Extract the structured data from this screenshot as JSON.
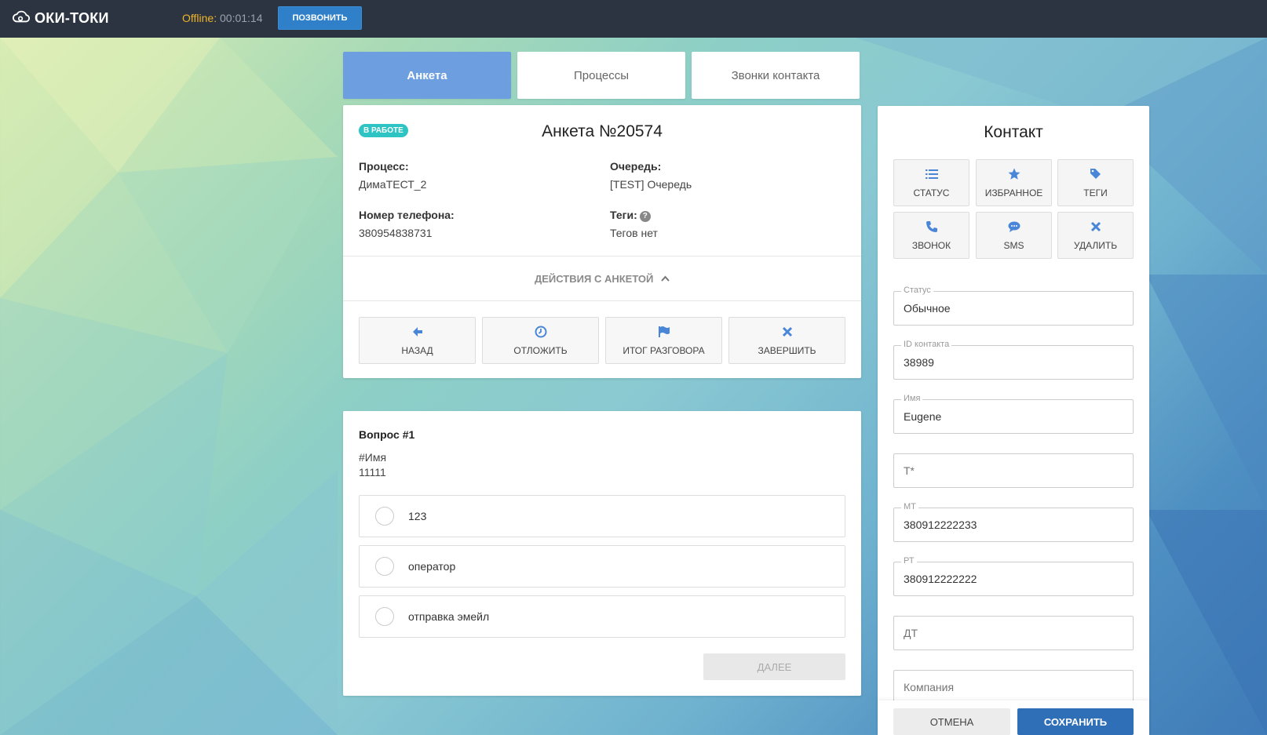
{
  "topbar": {
    "logo_text": "ОКИ-ТОКИ",
    "status_label": "Offline:",
    "status_time": "00:01:14",
    "call_button": "ПОЗВОНИТЬ"
  },
  "tabs": [
    {
      "label": "Анкета",
      "active": true
    },
    {
      "label": "Процессы",
      "active": false
    },
    {
      "label": "Звонки контакта",
      "active": false
    }
  ],
  "anketa": {
    "badge": "В РАБОТЕ",
    "title": "Анкета №20574",
    "process_label": "Процесс:",
    "process_value": "ДимаТЕСТ_2",
    "queue_label": "Очередь:",
    "queue_value": "[TEST] Очередь",
    "phone_label": "Номер телефона:",
    "phone_value": "380954838731",
    "tags_label": "Теги:",
    "tags_value": "Тегов нет",
    "actions_toggle": "ДЕЙСТВИЯ С АНКЕТОЙ",
    "actions": [
      {
        "label": "НАЗАД",
        "icon": "arrow-left-icon"
      },
      {
        "label": "ОТЛОЖИТЬ",
        "icon": "clock-icon"
      },
      {
        "label": "ИТОГ РАЗГОВОРА",
        "icon": "flag-icon"
      },
      {
        "label": "ЗАВЕРШИТЬ",
        "icon": "close-icon"
      }
    ]
  },
  "question": {
    "title": "Вопрос #1",
    "line1": "#Имя",
    "line2": "11111",
    "options": [
      "123",
      "оператор",
      "отправка эмейл"
    ],
    "next_button": "ДАЛЕЕ"
  },
  "contact": {
    "title": "Контакт",
    "buttons": [
      {
        "label": "СТАТУС",
        "icon": "list-icon"
      },
      {
        "label": "ИЗБРАННОЕ",
        "icon": "star-icon"
      },
      {
        "label": "ТЕГИ",
        "icon": "tags-icon"
      },
      {
        "label": "ЗВОНОК",
        "icon": "phone-icon"
      },
      {
        "label": "SMS",
        "icon": "chat-icon"
      },
      {
        "label": "УДАЛИТЬ",
        "icon": "close-icon"
      }
    ],
    "fields": [
      {
        "label": "Статус",
        "value": "Обычное"
      },
      {
        "label": "ID контакта",
        "value": "38989"
      },
      {
        "label": "Имя",
        "value": "Eugene"
      },
      {
        "label": "",
        "placeholder": "Т*"
      },
      {
        "label": "МТ",
        "value": "380912222233"
      },
      {
        "label": "РТ",
        "value": "380912222222"
      },
      {
        "label": "",
        "placeholder": "ДТ"
      },
      {
        "label": "",
        "placeholder": "Компания"
      }
    ],
    "cancel_button": "ОТМЕНА",
    "save_button": "СОХРАНИТЬ"
  },
  "colors": {
    "topbar": "#2b3440",
    "accent_blue": "#6c9ee0",
    "save_blue": "#2f6fb7",
    "badge_teal": "#2ec4c4",
    "offline_yellow": "#f0b429"
  }
}
